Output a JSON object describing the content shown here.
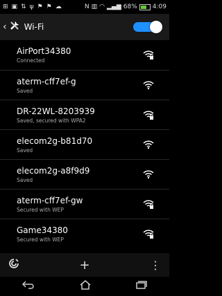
{
  "status_bar": {
    "battery": "68%",
    "time": "4:09"
  },
  "header": {
    "title": "Wi-Fi",
    "wifi_enabled": true
  },
  "networks": [
    {
      "ssid": "AirPort34380",
      "status": "Connected",
      "secured": true
    },
    {
      "ssid": "aterm-cff7ef-g",
      "status": "Saved",
      "secured": false
    },
    {
      "ssid": "DR-22WL-8203939",
      "status": "Saved, secured with WPA2",
      "secured": true
    },
    {
      "ssid": "elecom2g-b81d70",
      "status": "Saved",
      "secured": false
    },
    {
      "ssid": "elecom2g-a8f9d9",
      "status": "Saved",
      "secured": false
    },
    {
      "ssid": "aterm-cff7ef-gw",
      "status": "Secured with WEP",
      "secured": true
    },
    {
      "ssid": "Game34380",
      "status": "Secured with WEP",
      "secured": true
    }
  ],
  "bottom": {
    "add_label": "+",
    "menu_label": "⋮"
  },
  "icons": [
    "wps-icon",
    "add-icon",
    "overflow-menu-icon",
    "back-icon",
    "home-icon",
    "recents-icon"
  ]
}
